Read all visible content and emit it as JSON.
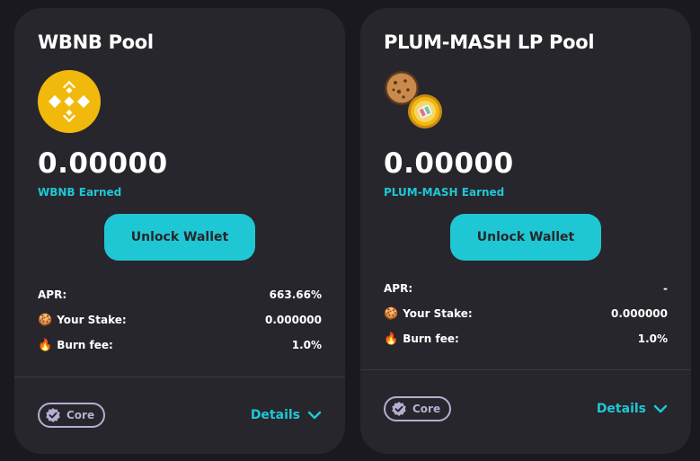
{
  "pools": [
    {
      "title": "WBNB Pool",
      "earned_amount": "0.00000",
      "earned_label": "WBNB Earned",
      "unlock_label": "Unlock Wallet",
      "apr_label": "APR:",
      "apr_value": "663.66%",
      "stake_label": "Your Stake:",
      "stake_value": "0.000000",
      "burn_label": "Burn fee:",
      "burn_value": "1.0%",
      "core_label": "Core",
      "details_label": "Details",
      "logo_icon": "binance-icon"
    },
    {
      "title": "PLUM-MASH LP Pool",
      "earned_amount": "0.00000",
      "earned_label": "PLUM-MASH Earned",
      "unlock_label": "Unlock Wallet",
      "apr_label": "APR:",
      "apr_value": "-",
      "stake_label": "Your Stake:",
      "stake_value": "0.000000",
      "burn_label": "Burn fee:",
      "burn_value": "1.0%",
      "core_label": "Core",
      "details_label": "Details",
      "logo_icon": "lp-pair-icon"
    }
  ],
  "colors": {
    "accent": "#1fc7d4",
    "card_bg": "#27262c",
    "page_bg": "#1a191f",
    "badge": "#b8add2",
    "bnb": "#f0b90b"
  },
  "emojis": {
    "stake": "🍪",
    "burn": "🔥"
  }
}
